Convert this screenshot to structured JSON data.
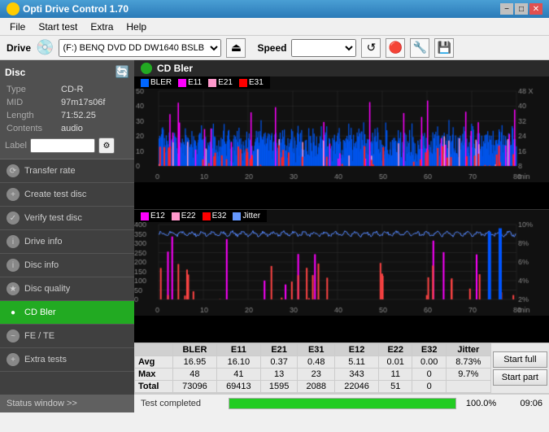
{
  "titleBar": {
    "icon": "disc",
    "title": "Opti Drive Control 1.70",
    "minimize": "−",
    "maximize": "□",
    "close": "✕"
  },
  "menuBar": {
    "items": [
      "File",
      "Start test",
      "Extra",
      "Help"
    ]
  },
  "driveBar": {
    "driveLabel": "Drive",
    "driveValue": "(F:)  BENQ DVD DD DW1640 BSLB",
    "speedLabel": "Speed",
    "speedValue": ""
  },
  "disc": {
    "header": "Disc",
    "type_label": "Type",
    "type_value": "CD-R",
    "mid_label": "MID",
    "mid_value": "97m17s06f",
    "length_label": "Length",
    "length_value": "71:52.25",
    "contents_label": "Contents",
    "contents_value": "audio",
    "label_label": "Label"
  },
  "nav": {
    "items": [
      {
        "id": "transfer-rate",
        "label": "Transfer rate",
        "active": false
      },
      {
        "id": "create-test-disc",
        "label": "Create test disc",
        "active": false
      },
      {
        "id": "verify-test-disc",
        "label": "Verify test disc",
        "active": false
      },
      {
        "id": "drive-info",
        "label": "Drive info",
        "active": false
      },
      {
        "id": "disc-info",
        "label": "Disc info",
        "active": false
      },
      {
        "id": "disc-quality",
        "label": "Disc quality",
        "active": false
      },
      {
        "id": "cd-bler",
        "label": "CD Bler",
        "active": true
      },
      {
        "id": "fe-te",
        "label": "FE / TE",
        "active": false
      },
      {
        "id": "extra-tests",
        "label": "Extra tests",
        "active": false
      }
    ],
    "statusWindow": "Status window >>"
  },
  "chartUpper": {
    "legend": [
      {
        "label": "BLER",
        "color": "#0066ff"
      },
      {
        "label": "E11",
        "color": "#ff00ff"
      },
      {
        "label": "E21",
        "color": "#ff66cc"
      },
      {
        "label": "E31",
        "color": "#ff0000"
      }
    ],
    "yAxisMax": 50,
    "xAxisMax": 80,
    "rightAxisLabel": "X",
    "rightAxisValues": [
      "48",
      "40",
      "32",
      "24",
      "16",
      "8"
    ]
  },
  "chartLower": {
    "legend": [
      {
        "label": "E12",
        "color": "#ff00ff"
      },
      {
        "label": "E22",
        "color": "#ff66cc"
      },
      {
        "label": "E32",
        "color": "#ff0000"
      },
      {
        "label": "Jitter",
        "color": "#0066ff"
      }
    ],
    "yAxisMax": 400,
    "xAxisMax": 80
  },
  "statsTable": {
    "headers": [
      "",
      "BLER",
      "E11",
      "E21",
      "E31",
      "E12",
      "E22",
      "E32",
      "Jitter"
    ],
    "rows": [
      {
        "label": "Avg",
        "values": [
          "16.95",
          "16.10",
          "0.37",
          "0.48",
          "5.11",
          "0.01",
          "0.00",
          "8.73%"
        ]
      },
      {
        "label": "Max",
        "values": [
          "48",
          "41",
          "13",
          "23",
          "343",
          "11",
          "0",
          "9.7%"
        ]
      },
      {
        "label": "Total",
        "values": [
          "73096",
          "69413",
          "1595",
          "2088",
          "22046",
          "51",
          "0",
          ""
        ]
      }
    ]
  },
  "buttons": {
    "startFull": "Start full",
    "startPart": "Start part"
  },
  "bottomBar": {
    "statusText": "Test completed",
    "progressPercent": "100.0%",
    "progressValue": 100,
    "time": "09:06"
  },
  "colors": {
    "accent": "#22aa22",
    "titleBg": "#3a8fc8",
    "sidebarBg": "#404040",
    "chartBg": "#000000"
  }
}
